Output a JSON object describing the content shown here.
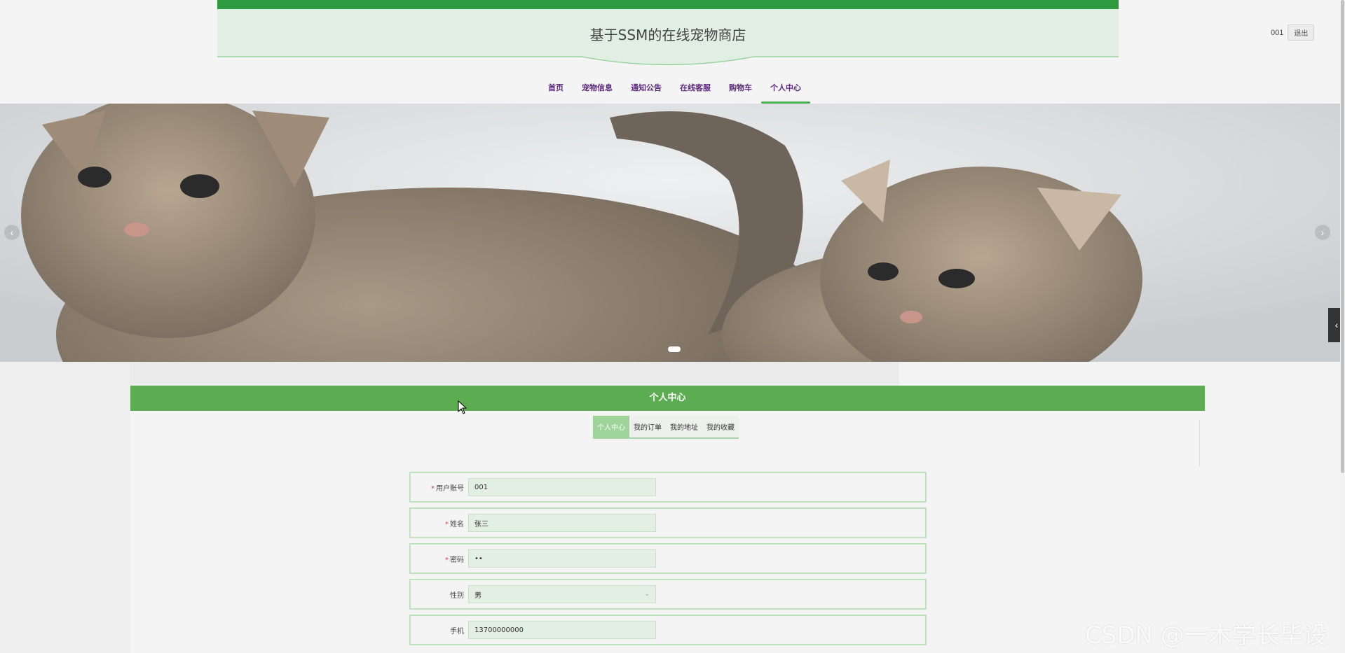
{
  "header": {
    "site_title": "基于SSM的在线宠物商店",
    "user": "001",
    "logout_label": "退出"
  },
  "nav": {
    "items": [
      {
        "label": "首页"
      },
      {
        "label": "宠物信息"
      },
      {
        "label": "通知公告"
      },
      {
        "label": "在线客服"
      },
      {
        "label": "购物车"
      },
      {
        "label": "个人中心"
      }
    ],
    "active_index": 5
  },
  "carousel": {
    "left_arrow": "‹",
    "right_arrow": "›",
    "side_tab": "‹"
  },
  "section": {
    "title": "个人中心"
  },
  "sub_tabs": [
    {
      "label": "个人中心"
    },
    {
      "label": "我的订单"
    },
    {
      "label": "我的地址"
    },
    {
      "label": "我的收藏"
    }
  ],
  "form": {
    "fields": [
      {
        "label": "用户账号",
        "value": "001",
        "required": "*"
      },
      {
        "label": "姓名",
        "value": "张三",
        "required": "*"
      },
      {
        "label": "密码",
        "value": "••",
        "required": "*"
      },
      {
        "label": "性别",
        "value": "男",
        "required": ""
      },
      {
        "label": "手机",
        "value": "13700000000",
        "required": ""
      }
    ]
  },
  "watermark": "CSDN @一木学长毕设",
  "colors": {
    "brand_green": "#2d9a3f",
    "section_green": "#5cad51",
    "nav_text": "#5b2a7a"
  }
}
